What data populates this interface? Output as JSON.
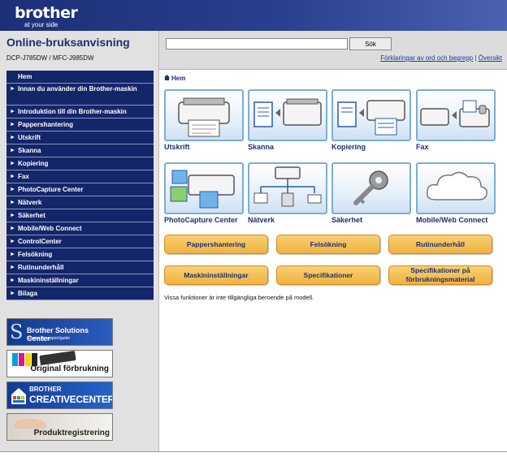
{
  "header": {
    "brand": "brother",
    "tagline": "at your side"
  },
  "sidebar": {
    "title": "Online-bruksanvisning",
    "model": "DCP-J785DW / MFC-J985DW",
    "items": [
      {
        "label": "Hem"
      },
      {
        "label": "Innan du använder din Brother-maskin"
      },
      {
        "label": "Introduktion till din Brother-maskin"
      },
      {
        "label": "Pappershantering"
      },
      {
        "label": "Utskrift"
      },
      {
        "label": "Skanna"
      },
      {
        "label": "Kopiering"
      },
      {
        "label": "Fax"
      },
      {
        "label": "PhotoCapture Center"
      },
      {
        "label": "Nätverk"
      },
      {
        "label": "Säkerhet"
      },
      {
        "label": "Mobile/Web Connect"
      },
      {
        "label": "ControlCenter"
      },
      {
        "label": "Felsökning"
      },
      {
        "label": "Rutinunderhåll"
      },
      {
        "label": "Maskininställningar"
      },
      {
        "label": "Bilaga"
      }
    ],
    "banners": {
      "solutions_title": "Brother Solutions Center",
      "solutions_sub": "Service & support/guide",
      "original": "Original förbrukning",
      "creative_top": "BROTHER",
      "creative_main": "CREATIVECENTER",
      "registration": "Produktregistrering"
    }
  },
  "search": {
    "value": "",
    "button": "Sök",
    "link_glossary": "Förklaringar av ord och begrepp",
    "separator": "|",
    "link_overview": "Översikt"
  },
  "main": {
    "breadcrumb": "Hem",
    "tiles": [
      {
        "label": "Utskrift",
        "icon": "printer-icon"
      },
      {
        "label": "Skanna",
        "icon": "scan-icon"
      },
      {
        "label": "Kopiering",
        "icon": "copy-icon"
      },
      {
        "label": "Fax",
        "icon": "fax-icon"
      },
      {
        "label": "PhotoCapture Center",
        "icon": "photo-icon"
      },
      {
        "label": "Nätverk",
        "icon": "network-icon"
      },
      {
        "label": "Säkerhet",
        "icon": "key-icon"
      },
      {
        "label": "Mobile/Web Connect",
        "icon": "cloud-icon"
      }
    ],
    "buttons": [
      "Pappershantering",
      "Felsökning",
      "Rutinunderhåll",
      "Maskininställningar",
      "Specifikationer",
      "Specifikationer på förbrukningsmaterial"
    ],
    "notice": "Vissa funktioner är inte tillgängliga beroende på modell."
  },
  "colors": {
    "nav_bg": "#14266a",
    "header_blue": "#1c2f78",
    "tile_border": "#7aaed6",
    "button_orange": "#f0b340"
  }
}
